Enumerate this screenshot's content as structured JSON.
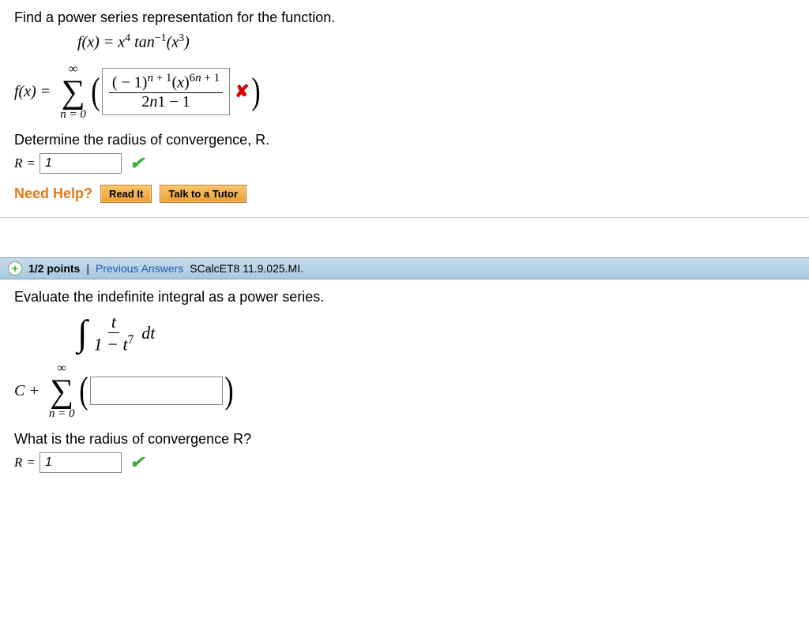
{
  "q1": {
    "prompt": "Find a power series representation for the function.",
    "func_lhs": "f(x) = ",
    "func_rhs_html": "x⁴ tan⁻¹(x³)",
    "answer_lhs": "f(x) = ",
    "sigma_top": "∞",
    "sigma_bottom": "n = 0",
    "series_numerator": "( − 1)ⁿ⁺¹(x)⁶ⁿ⁺¹",
    "series_denominator": "2n1 − 1",
    "series_correct": false,
    "sub_prompt": "Determine the radius of convergence, R.",
    "r_label": "R",
    "r_value": "1",
    "r_correct": true,
    "need_help_label": "Need Help?",
    "read_it": "Read It",
    "talk_tutor": "Talk to a Tutor"
  },
  "q2": {
    "header_points": "1/2 points",
    "header_divider": "|",
    "header_prev": "Previous Answers",
    "header_ref": "SCalcET8 11.9.025.MI.",
    "prompt": "Evaluate the indefinite integral as a power series.",
    "integral_num": "t",
    "integral_den": "1 − t⁷",
    "integral_dt": "dt",
    "answer_lhs": "C + ",
    "sigma_top": "∞",
    "sigma_bottom": "n = 0",
    "series_value": "",
    "sub_prompt": "What is the radius of convergence R?",
    "r_label": "R",
    "r_value": "1",
    "r_correct": true
  }
}
